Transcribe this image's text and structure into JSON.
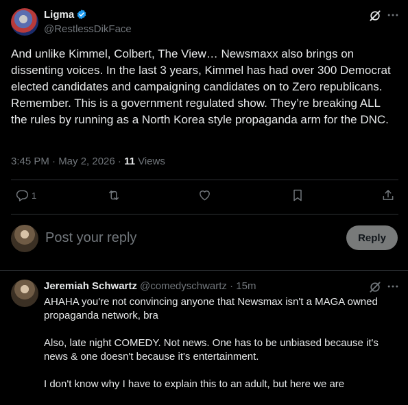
{
  "tweet": {
    "author_name": "Ligma",
    "author_handle": "@RestlessDikFace",
    "text": "And unlike Kimmel, Colbert, The View… Newsmaxx also brings on dissenting voices. In the last 3 years, Kimmel has had over 300 Democrat elected candidates and campaigning candidates on to Zero republicans. Remember. This is a government regulated show. They’re breaking ALL the rules by running as a North Korea style propaganda arm for the DNC.",
    "timestamp": "3:45 PM · May 2, 2026",
    "separator": " · ",
    "views_count": "11",
    "views_label": " Views",
    "reply_count": "1"
  },
  "icons": {
    "verified": "verified-badge-icon",
    "grok": "grok-icon",
    "more": "more-icon",
    "reply": "reply-icon",
    "retweet": "retweet-icon",
    "like": "like-icon",
    "bookmark": "bookmark-icon",
    "share": "share-icon"
  },
  "compose": {
    "placeholder": "Post your reply",
    "button_label": "Reply"
  },
  "reply": {
    "author_name": "Jeremiah Schwartz",
    "author_handle": "@comedyschwartz · 15m",
    "paragraphs": [
      "AHAHA you're not convincing anyone that Newsmax isn't a MAGA owned propaganda network, bra",
      "Also, late night COMEDY. Not news. One has to be unbiased because it's news & one doesn't because it's entertainment.",
      "I don't know why I have to explain this to an adult, but here we are"
    ]
  },
  "colors": {
    "background": "#000000",
    "text": "#e7e9ea",
    "muted": "#71767b",
    "verified": "#1d9bf0",
    "divider": "#2f3336",
    "reply_button": "#787a7a"
  }
}
